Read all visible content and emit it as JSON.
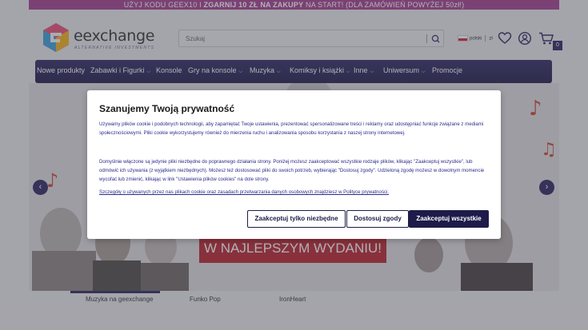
{
  "promo": {
    "pre": "UŻYJ KODU GEEX10 I ",
    "bold": "ZGARNIJ 10 ZŁ NA ZAKUPY",
    "post": " NA START! (DLA ZAMÓWIEŃ POWYŻEJ 50zł!)"
  },
  "header": {
    "logo_text": "eexchange",
    "logo_sub": "ALTERNATIVE INVESTMENTS",
    "search_placeholder": "Szukaj",
    "lang_label": "polski",
    "currency": "zł",
    "cart_count": "0"
  },
  "nav": {
    "items": [
      {
        "label": "Nowe produkty",
        "dropdown": false
      },
      {
        "label": "Zabawki i Figurki",
        "dropdown": true
      },
      {
        "label": "Konsole",
        "dropdown": false
      },
      {
        "label": "Gry na konsole",
        "dropdown": true
      },
      {
        "label": "Muzyka",
        "dropdown": true
      },
      {
        "label": "Komiksy i książki",
        "dropdown": true
      },
      {
        "label": "Inne",
        "dropdown": true
      },
      {
        "label": "Uniwersum",
        "dropdown": true
      },
      {
        "label": "Promocje",
        "dropdown": false
      }
    ],
    "chevron": "⌵"
  },
  "banner": {
    "headline": "W NAJLEPSZYM WYDANIU!",
    "prev": "‹",
    "next": "›"
  },
  "tabs": [
    "Muzyka na geexchange",
    "Funko Pop",
    "IronHeart"
  ],
  "cookie": {
    "title": "Szanujemy Twoją prywatność",
    "p1": "Używamy plików cookie i podobnych technologii, aby zapamiętać Twoje ustawienia, prezentować spersonalizowane treści i reklamy oraz udostępniać funkcje związane z mediami społecznościowymi. Pliki cookie wykorzystujemy również do mierzenia ruchu i analizowania sposobu korzystania z naszej strony internetowej.",
    "p2": "Domyślnie włączone są jedynie pliki niezbędne do poprawnego działania strony. Poniżej możesz zaakceptować wszystkie rodzaje plików, klikając \"Zaakceptuj wszystkie\", lub odmówić ich używania (z wyjątkiem niezbędnych). Możesz też dostosować pliki do swoich potrzeb, wybierając \"Dostosuj zgody\". Udzieloną zgodę możesz w dowolnym momencie wycofać lub zmienić, klikając w link \"Ustawienia plików cookies\" na dole strony.",
    "link": "Szczegóły o używanych przez nas plikach cookie oraz zasadach przetwarzania danych osobowych znajdziesz w Polityce prywatności.",
    "btn_necessary": "Zaakceptuj tylko niezbędne",
    "btn_customize": "Dostosuj zgody",
    "btn_accept_all": "Zaakceptuj wszystkie"
  },
  "colors": {
    "brand": "#2b2560",
    "promo_bg": "#a33e8e",
    "banner_red": "#b8232e",
    "cookie_text": "#2b2b8c"
  }
}
